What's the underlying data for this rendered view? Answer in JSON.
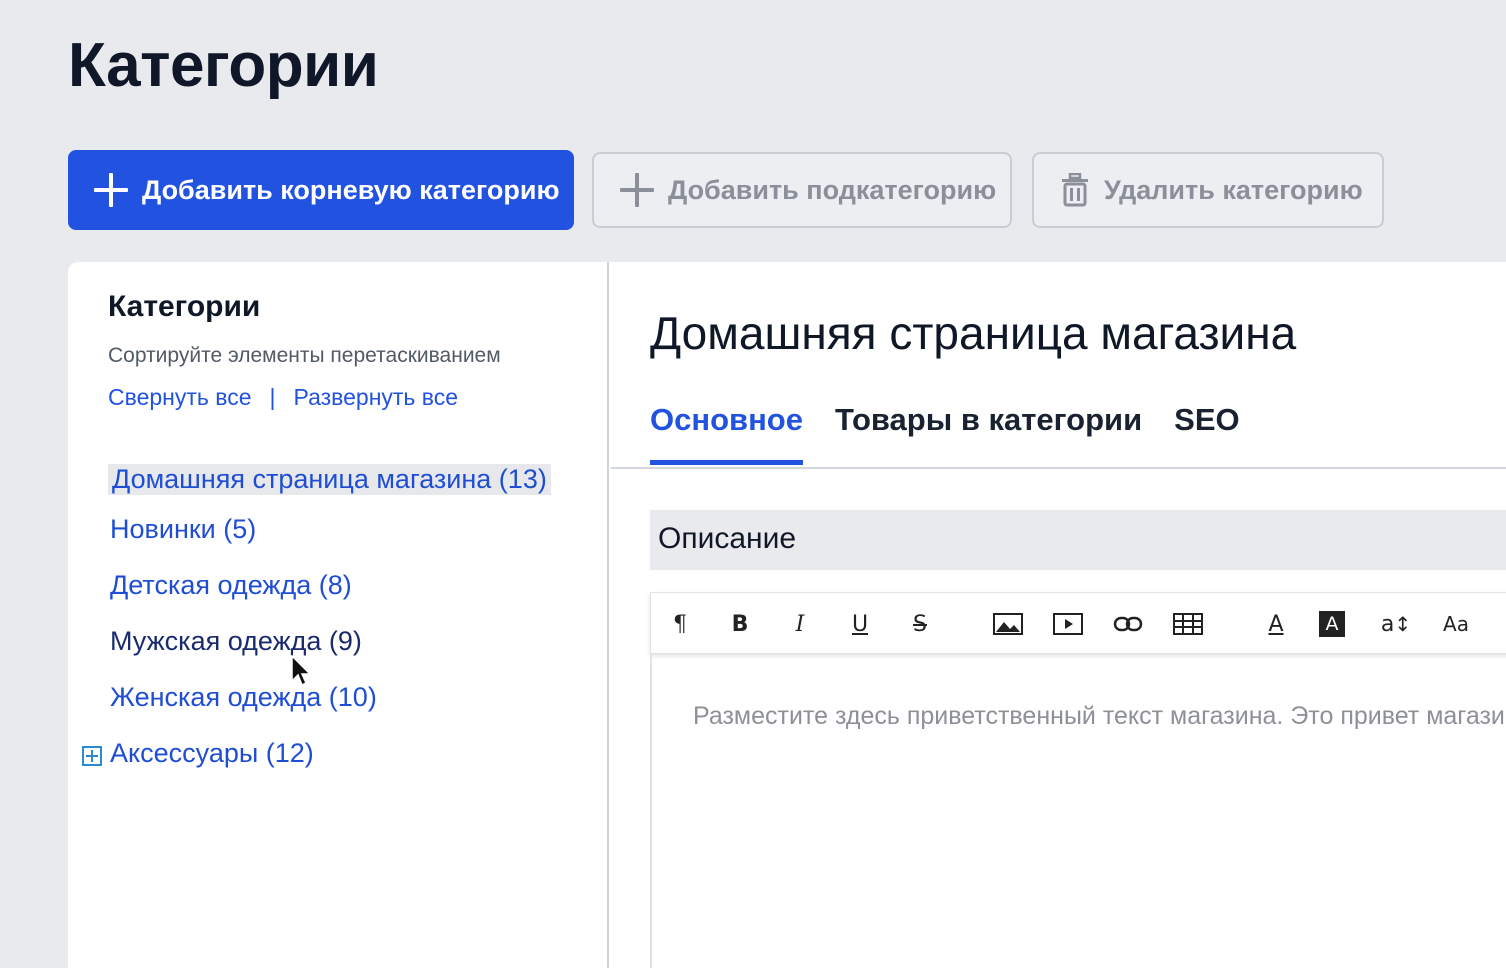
{
  "page": {
    "title": "Категории"
  },
  "toolbar": {
    "add_root": "Добавить корневую категорию",
    "add_sub": "Добавить подкатегорию",
    "delete": "Удалить категорию"
  },
  "sidebar": {
    "title": "Категории",
    "hint": "Сортируйте элементы перетаскиванием",
    "collapse_all": "Свернуть все",
    "separator": "|",
    "expand_all": "Развернуть все",
    "items": [
      {
        "label": "Домашняя страница магазина (13)",
        "selected": true
      },
      {
        "label": "Новинки (5)"
      },
      {
        "label": "Детская одежда (8)"
      },
      {
        "label": "Мужская одежда (9)"
      },
      {
        "label": "Женская одежда (10)"
      },
      {
        "label": "Аксессуары (12)",
        "expandable": true
      }
    ]
  },
  "content": {
    "title": "Домашняя страница магазина",
    "tabs": [
      {
        "label": "Основное",
        "active": true
      },
      {
        "label": "Товары в категории"
      },
      {
        "label": "SEO"
      }
    ],
    "section_title": "Описание",
    "editor_tools": [
      "paragraph-icon",
      "bold-icon",
      "italic-icon",
      "underline-icon",
      "strikethrough-icon",
      "image-icon",
      "video-icon",
      "link-icon",
      "table-icon",
      "font-color-icon",
      "highlight-icon",
      "line-height-icon",
      "font-size-icon"
    ],
    "editor_labels": {
      "paragraph": "¶",
      "bold": "B",
      "italic": "I",
      "underline": "U",
      "strike": "S",
      "text_color": "A",
      "highlight": "A",
      "line_height": "a",
      "font_size": "Aa"
    },
    "placeholder": "Разместите здесь приветственный текст магазина. Это привет магазина."
  },
  "colors": {
    "accent": "#2152e0",
    "background": "#e9eaee"
  }
}
